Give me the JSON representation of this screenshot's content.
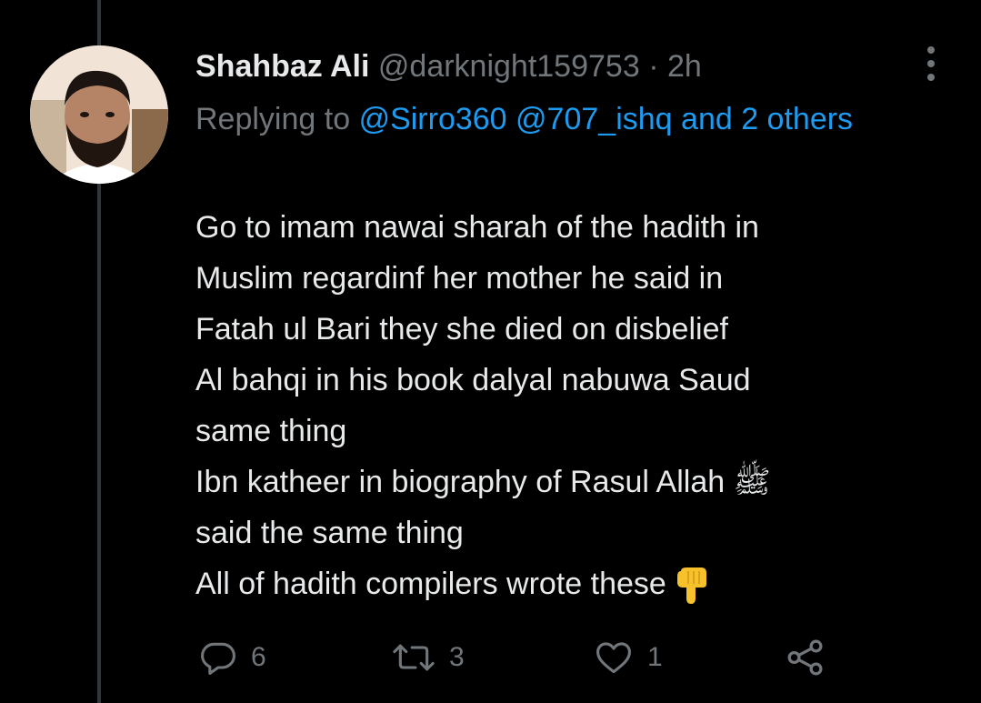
{
  "tweet": {
    "author_name": "Shahbaz Ali",
    "handle": "@darknight159753",
    "separator": "·",
    "time": "2h",
    "replying_prefix": "Replying to",
    "mention_1": "@Sirro360",
    "mention_2": "@707_ishq",
    "and_others": "and 2 others",
    "body_lines": [
      "Go to imam nawai sharah of the hadith in",
      "Muslim regardinf her mother he said in",
      "Fatah ul Bari they she died on disbelief",
      "Al bahqi in his book dalyal nabuwa Saud",
      "same thing",
      "Ibn katheer in biography of Rasul Allah ﷺ",
      "said the same thing",
      "All of hadith compilers wrote these"
    ],
    "emoji": "👇"
  },
  "actions": {
    "reply_count": "6",
    "retweet_count": "3",
    "like_count": "1"
  },
  "colors": {
    "background": "#000000",
    "text_primary": "#e7e9ea",
    "text_secondary": "#71767b",
    "link": "#1d9bf0",
    "thread_line": "#333639"
  }
}
